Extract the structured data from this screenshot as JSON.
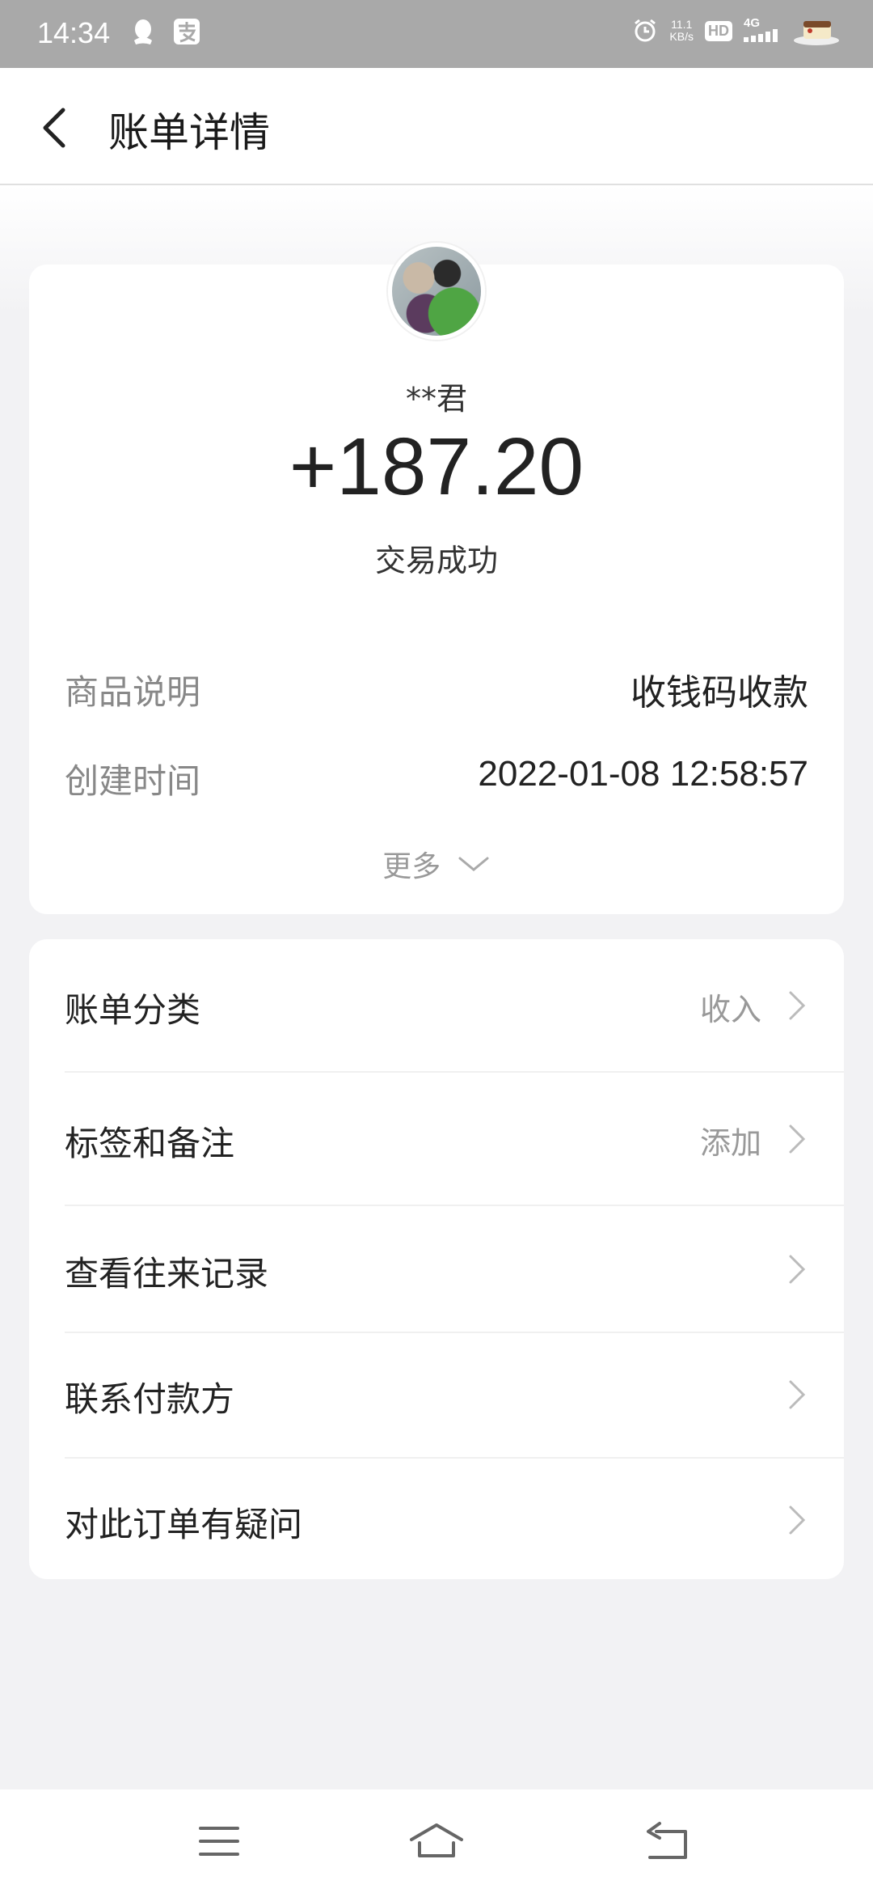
{
  "status_bar": {
    "time": "14:34",
    "net_speed_value": "11.1",
    "net_speed_unit": "KB/s",
    "hd_label": "HD",
    "network_label": "4G",
    "icons": [
      "qq-icon",
      "alipay-icon",
      "alarm-icon",
      "signal-icon",
      "battery-icon"
    ]
  },
  "header": {
    "title": "账单详情"
  },
  "summary": {
    "payer_name": "**君",
    "amount": "+187.20",
    "status": "交易成功"
  },
  "details": [
    {
      "label": "商品说明",
      "value": "收钱码收款"
    },
    {
      "label": "创建时间",
      "value": "2022-01-08 12:58:57"
    }
  ],
  "more_label": "更多",
  "menu": [
    {
      "label": "账单分类",
      "value": "收入"
    },
    {
      "label": "标签和备注",
      "value": "添加"
    },
    {
      "label": "查看往来记录",
      "value": ""
    },
    {
      "label": "联系付款方",
      "value": ""
    },
    {
      "label": "对此订单有疑问",
      "value": ""
    }
  ],
  "nav": {
    "icons": [
      "menu-icon",
      "home-icon",
      "back-nav-icon"
    ]
  },
  "colors": {
    "status_bar": "#a9a9a9",
    "background": "#f2f2f4",
    "card": "#ffffff",
    "primary_text": "#222222",
    "secondary_text": "#888888"
  }
}
